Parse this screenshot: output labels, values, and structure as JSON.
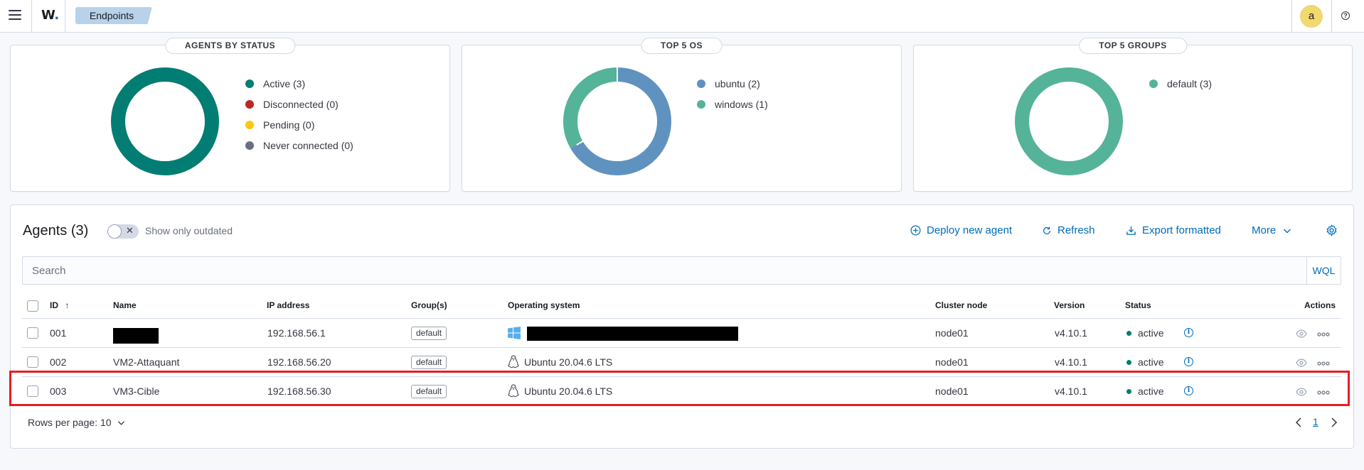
{
  "topbar": {
    "logo_text": "W",
    "breadcrumb": "Endpoints",
    "avatar_letter": "a",
    "help_glyph": "?"
  },
  "panels": [
    {
      "title": "AGENTS BY STATUS",
      "legend": [
        {
          "label": "Active (3)",
          "color": "#017d73"
        },
        {
          "label": "Disconnected (0)",
          "color": "#bd271e"
        },
        {
          "label": "Pending (0)",
          "color": "#fec514"
        },
        {
          "label": "Never connected (0)",
          "color": "#69707d"
        }
      ]
    },
    {
      "title": "TOP 5 OS",
      "legend": [
        {
          "label": "ubuntu (2)",
          "color": "#6092c0"
        },
        {
          "label": "windows (1)",
          "color": "#54b399"
        }
      ]
    },
    {
      "title": "TOP 5 GROUPS",
      "legend": [
        {
          "label": "default (3)",
          "color": "#54b399"
        }
      ]
    }
  ],
  "chart_data": [
    {
      "type": "pie",
      "categories": [
        "Active",
        "Disconnected",
        "Pending",
        "Never connected"
      ],
      "values": [
        3,
        0,
        0,
        0
      ]
    },
    {
      "type": "pie",
      "categories": [
        "ubuntu",
        "windows"
      ],
      "values": [
        2,
        1
      ]
    },
    {
      "type": "pie",
      "categories": [
        "default"
      ],
      "values": [
        3
      ]
    }
  ],
  "agents": {
    "title": "Agents (3)",
    "toggle_label": "Show only outdated",
    "actions": {
      "deploy": "Deploy new agent",
      "refresh": "Refresh",
      "export": "Export formatted",
      "more": "More"
    },
    "search_placeholder": "Search",
    "wql": "WQL",
    "columns": {
      "id": "ID",
      "name": "Name",
      "ip": "IP address",
      "groups": "Group(s)",
      "os": "Operating system",
      "node": "Cluster node",
      "version": "Version",
      "status": "Status",
      "actions": "Actions"
    },
    "rows": [
      {
        "id": "001",
        "name": "",
        "ip": "192.168.56.1",
        "group": "default",
        "os": "",
        "os_icon": "windows-icon",
        "node": "node01",
        "version": "v4.10.1",
        "status": "active"
      },
      {
        "id": "002",
        "name": "VM2-Attaquant",
        "ip": "192.168.56.20",
        "group": "default",
        "os": "Ubuntu 20.04.6 LTS",
        "os_icon": "linux-icon",
        "node": "node01",
        "version": "v4.10.1",
        "status": "active"
      },
      {
        "id": "003",
        "name": "VM3-Cible",
        "ip": "192.168.56.30",
        "group": "default",
        "os": "Ubuntu 20.04.6 LTS",
        "os_icon": "linux-icon",
        "node": "node01",
        "version": "v4.10.1",
        "status": "active"
      }
    ],
    "rows_per_page": "Rows per page: 10",
    "current_page": "1"
  }
}
